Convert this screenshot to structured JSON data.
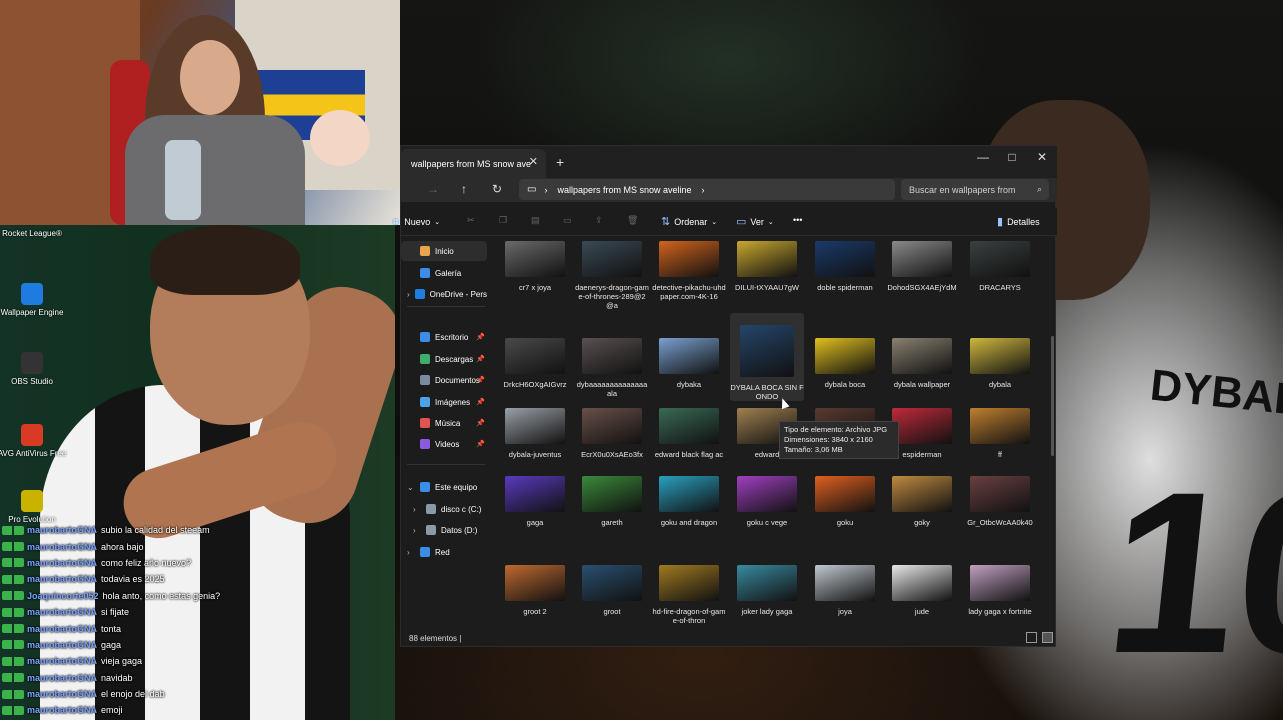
{
  "desktop": {
    "icons": [
      {
        "label": "Rocket League®",
        "color": "#2a5bd7"
      },
      {
        "label": "Wallpaper Engine",
        "color": "#1e7be0"
      },
      {
        "label": "OBS Studio",
        "color": "#333333"
      },
      {
        "label": "AVG AntiVirus Free",
        "color": "#d83a24"
      },
      {
        "label": "Pro Evolution",
        "color": "#c9b200"
      }
    ]
  },
  "chat": [
    {
      "user": "maurobartoGNA",
      "msg": "subio la calidad del steeam"
    },
    {
      "user": "maurobartoGNA",
      "msg": "ahora bajo"
    },
    {
      "user": "maurobartoGNA",
      "msg": "como feliz año nuevo?"
    },
    {
      "user": "maurobartoGNA",
      "msg": "todavia es 2025"
    },
    {
      "user": "Joaquincorte052",
      "msg": "hola anto, como estas genia?"
    },
    {
      "user": "maurobartoGNA",
      "msg": "si fijate"
    },
    {
      "user": "maurobartoGNA",
      "msg": "tonta"
    },
    {
      "user": "maurobartoGNA",
      "msg": "gaga"
    },
    {
      "user": "maurobartoGNA",
      "msg": "vieja gaga"
    },
    {
      "user": "maurobartoGNA",
      "msg": "navidab"
    },
    {
      "user": "maurobartoGNA",
      "msg": "el enojo del dab"
    },
    {
      "user": "maurobartoGNA",
      "msg": "emoji"
    }
  ],
  "explorer": {
    "tab_title": "wallpapers from MS snow ave",
    "new_tab": "+",
    "address": "wallpapers from MS snow aveline",
    "search_placeholder": "Buscar en wallpapers from",
    "toolbar": {
      "new": "Nuevo",
      "sort": "Ordenar",
      "view": "Ver",
      "more": "•••",
      "details": "Detalles"
    },
    "sidebar": [
      {
        "label": "Inicio",
        "color": "#e8a54b",
        "pin": false
      },
      {
        "label": "Galería",
        "color": "#3b8ee8",
        "pin": false
      },
      {
        "label": "OneDrive - Persona",
        "color": "#1f7fe0",
        "pin": false,
        "chevron": true
      },
      {
        "label": "Escritorio",
        "color": "#3b8ee8",
        "pin": true
      },
      {
        "label": "Descargas",
        "color": "#3fae6a",
        "pin": true
      },
      {
        "label": "Documentos",
        "color": "#7a8aa0",
        "pin": true
      },
      {
        "label": "Imágenes",
        "color": "#4aa3e8",
        "pin": true
      },
      {
        "label": "Música",
        "color": "#e0554f",
        "pin": true
      },
      {
        "label": "Videos",
        "color": "#8a5ae0",
        "pin": true
      },
      {
        "label": "Este equipo",
        "color": "#3b8ee8",
        "chevron": true
      },
      {
        "label": "disco c (C:)",
        "color": "#8a9aa8",
        "chevron": true
      },
      {
        "label": "Datos (D:)",
        "color": "#8a9aa8",
        "chevron": true
      },
      {
        "label": "Red",
        "color": "#3b8ee8",
        "chevron": true
      }
    ],
    "files": [
      {
        "name": "cr7 x joya",
        "color": "#6a6a6a"
      },
      {
        "name": "daenerys-dragon-game-of-thrones-289@2@a",
        "color": "#3a4a55"
      },
      {
        "name": "detective-pikachu-uhdpaper.com-4K-16",
        "color": "#d2641c"
      },
      {
        "name": "DILUI-tXYAAU7gW",
        "color": "#c9a830"
      },
      {
        "name": "doble spiderman",
        "color": "#1a3a6a"
      },
      {
        "name": "DohodSGX4AEjYdM",
        "color": "#8a8a8a"
      },
      {
        "name": "DRACARYS",
        "color": "#3a4040"
      },
      {
        "name": "DrkcH6OXgAIGvrz",
        "color": "#4a4a4a"
      },
      {
        "name": "dybaaaaaaaaaaaaaaala",
        "color": "#5a5050"
      },
      {
        "name": "dybaka",
        "color": "#7aa0d0"
      },
      {
        "name": "DYBALA BOCA SIN FONDO",
        "color": "#25456a"
      },
      {
        "name": "dybala boca",
        "color": "#e0c020"
      },
      {
        "name": "dybala wallpaper",
        "color": "#8a8070"
      },
      {
        "name": "dybala",
        "color": "#d0b840"
      },
      {
        "name": "dybala-juventus",
        "color": "#9aa0a8"
      },
      {
        "name": "EcrX0u0XsAEo3fx",
        "color": "#6a5048"
      },
      {
        "name": "edward black flag ac",
        "color": "#3a6a55"
      },
      {
        "name": "edward",
        "color": "#a08050"
      },
      {
        "name": "E8zu8sXG0AE_vW",
        "color": "#5a3a30"
      },
      {
        "name": "espiderman",
        "color": "#c02a3a"
      },
      {
        "name": "ff",
        "color": "#c08030"
      },
      {
        "name": "gaga",
        "color": "#5a3ac0"
      },
      {
        "name": "gareth",
        "color": "#3a8a3a"
      },
      {
        "name": "goku and dragon",
        "color": "#2aa0c0"
      },
      {
        "name": "goku c vege",
        "color": "#a040c0"
      },
      {
        "name": "goku",
        "color": "#e06020"
      },
      {
        "name": "goky",
        "color": "#c08a40"
      },
      {
        "name": "Gr_OtbcWcAA0k40",
        "color": "#6a4040"
      },
      {
        "name": "groot 2",
        "color": "#c06a30"
      },
      {
        "name": "groot",
        "color": "#2a5070"
      },
      {
        "name": "hd-fire-dragon-of-game-of-thron",
        "color": "#a07a20"
      },
      {
        "name": "joker lady gaga",
        "color": "#3a8aa0"
      },
      {
        "name": "joya",
        "color": "#c0c8d0"
      },
      {
        "name": "jude",
        "color": "#e8e8e8"
      },
      {
        "name": "lady gaga x fortnite",
        "color": "#c0a0c0"
      }
    ],
    "tooltip": {
      "type": "Tipo de elemento: Archivo JPG",
      "dims": "Dimensiones: 3840 x 2160",
      "size": "Tamaño: 3,06 MB"
    },
    "status": "88 elementos |"
  },
  "background": {
    "jersey_name": "DYBALA",
    "jersey_number": "10"
  }
}
